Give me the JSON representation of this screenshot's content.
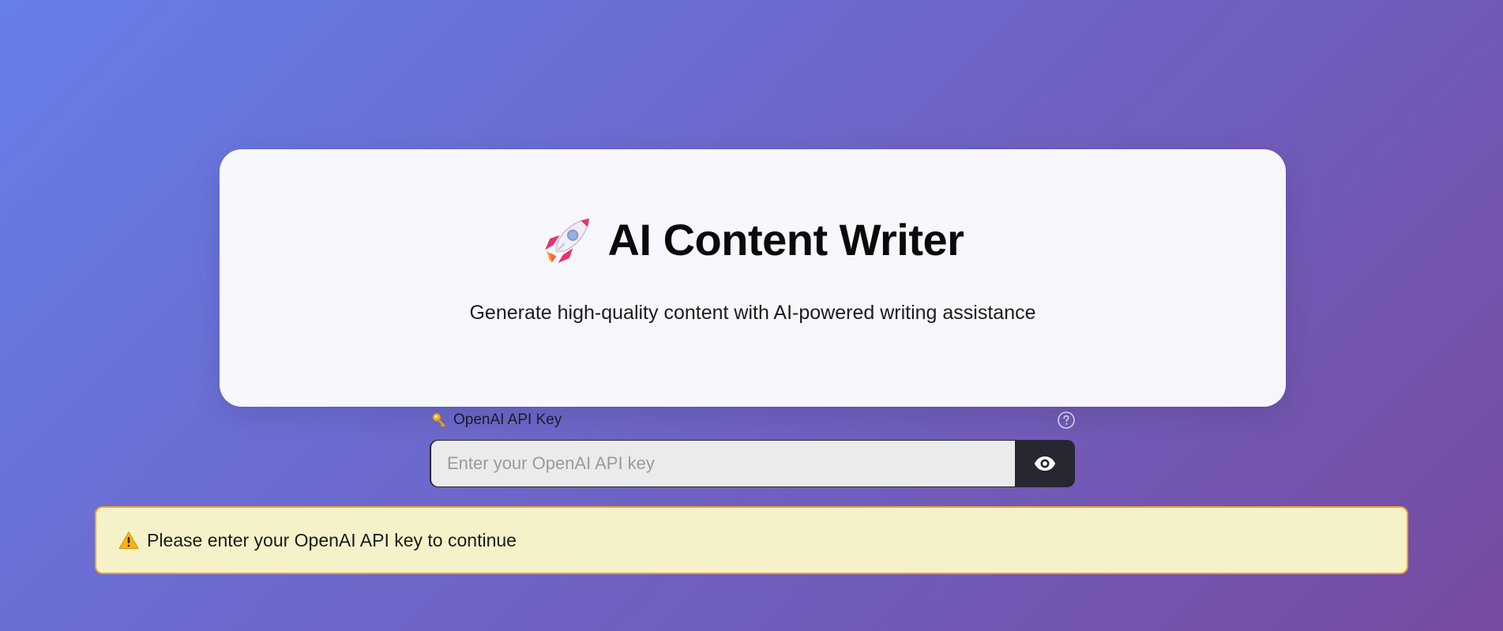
{
  "hero": {
    "rocket_icon": "rocket-emoji-icon",
    "title": "AI Content Writer",
    "subtitle": "Generate high-quality content with AI-powered writing assistance"
  },
  "api_key": {
    "label_icon": "key-emoji-icon",
    "label": "OpenAI API Key",
    "help_icon": "question-circle-icon",
    "value": "",
    "placeholder": "Enter your OpenAI API key",
    "toggle_icon": "eye-icon"
  },
  "warning": {
    "icon": "warning-triangle-icon",
    "message": "Please enter your OpenAI API key to continue"
  },
  "colors": {
    "background_gradient_start": "#667eea",
    "background_gradient_end": "#764ba2",
    "card_background": "#f8f7fc",
    "input_background": "#ebebeb",
    "input_button_background": "#262730",
    "warning_background": "#f5f2c9",
    "warning_border": "#f0a528"
  }
}
